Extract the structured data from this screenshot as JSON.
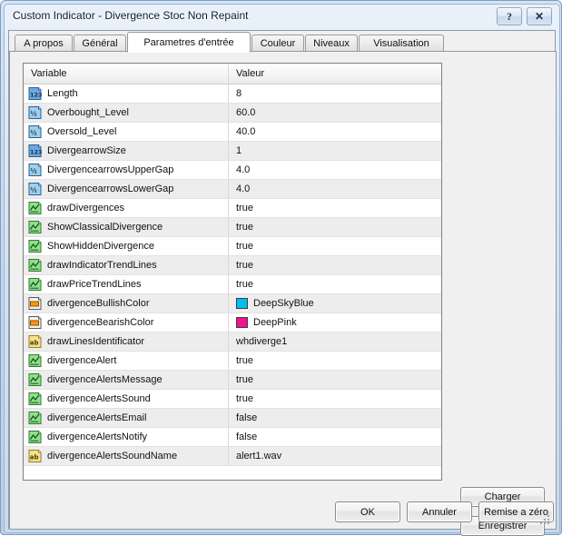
{
  "window": {
    "title": "Custom Indicator - Divergence Stoc Non Repaint",
    "help_button": "?",
    "close_button": "✕"
  },
  "tabs": [
    {
      "label": "A propos",
      "active": false
    },
    {
      "label": "Général",
      "active": false
    },
    {
      "label": "Parametres d'entrée",
      "active": true
    },
    {
      "label": "Couleur",
      "active": false
    },
    {
      "label": "Niveaux",
      "active": false
    },
    {
      "label": "Visualisation",
      "active": false
    }
  ],
  "table": {
    "columns": [
      "Variable",
      "Valeur"
    ],
    "rows": [
      {
        "icon": "int-icon",
        "variable": "Length",
        "value": "8"
      },
      {
        "icon": "double-icon",
        "variable": "Overbought_Level",
        "value": "60.0"
      },
      {
        "icon": "double-icon",
        "variable": "Oversold_Level",
        "value": "40.0"
      },
      {
        "icon": "int-icon",
        "variable": "DivergearrowSize",
        "value": "1"
      },
      {
        "icon": "double-icon",
        "variable": "DivergencearrowsUpperGap",
        "value": "4.0"
      },
      {
        "icon": "double-icon",
        "variable": "DivergencearrowsLowerGap",
        "value": "4.0"
      },
      {
        "icon": "bool-icon",
        "variable": "drawDivergences",
        "value": "true"
      },
      {
        "icon": "bool-icon",
        "variable": "ShowClassicalDivergence",
        "value": "true"
      },
      {
        "icon": "bool-icon",
        "variable": "ShowHiddenDivergence",
        "value": "true"
      },
      {
        "icon": "bool-icon",
        "variable": "drawIndicatorTrendLines",
        "value": "true"
      },
      {
        "icon": "bool-icon",
        "variable": "drawPriceTrendLines",
        "value": "true"
      },
      {
        "icon": "color-icon",
        "variable": "divergenceBullishColor",
        "value": "DeepSkyBlue",
        "swatch": "#00BFF0"
      },
      {
        "icon": "color-icon",
        "variable": "divergenceBearishColor",
        "value": "DeepPink",
        "swatch": "#F4128E"
      },
      {
        "icon": "string-icon",
        "variable": "drawLinesIdentificator",
        "value": "whdiverge1"
      },
      {
        "icon": "bool-icon",
        "variable": "divergenceAlert",
        "value": "true"
      },
      {
        "icon": "bool-icon",
        "variable": "divergenceAlertsMessage",
        "value": "true"
      },
      {
        "icon": "bool-icon",
        "variable": "divergenceAlertsSound",
        "value": "true"
      },
      {
        "icon": "bool-icon",
        "variable": "divergenceAlertsEmail",
        "value": "false"
      },
      {
        "icon": "bool-icon",
        "variable": "divergenceAlertsNotify",
        "value": "false"
      },
      {
        "icon": "string-icon",
        "variable": "divergenceAlertsSoundName",
        "value": "alert1.wav"
      }
    ]
  },
  "side_buttons": {
    "load": "Charger",
    "save": "Enregistrer"
  },
  "bottom_buttons": {
    "ok": "OK",
    "cancel": "Annuler",
    "reset": "Remise a zéro"
  },
  "colors": {
    "deep_sky_blue": "#00BFF0",
    "deep_pink": "#F4128E",
    "title_text": "#0a1a33",
    "dialog_bg": "#f0f0f0",
    "row_alt": "#ededed"
  }
}
